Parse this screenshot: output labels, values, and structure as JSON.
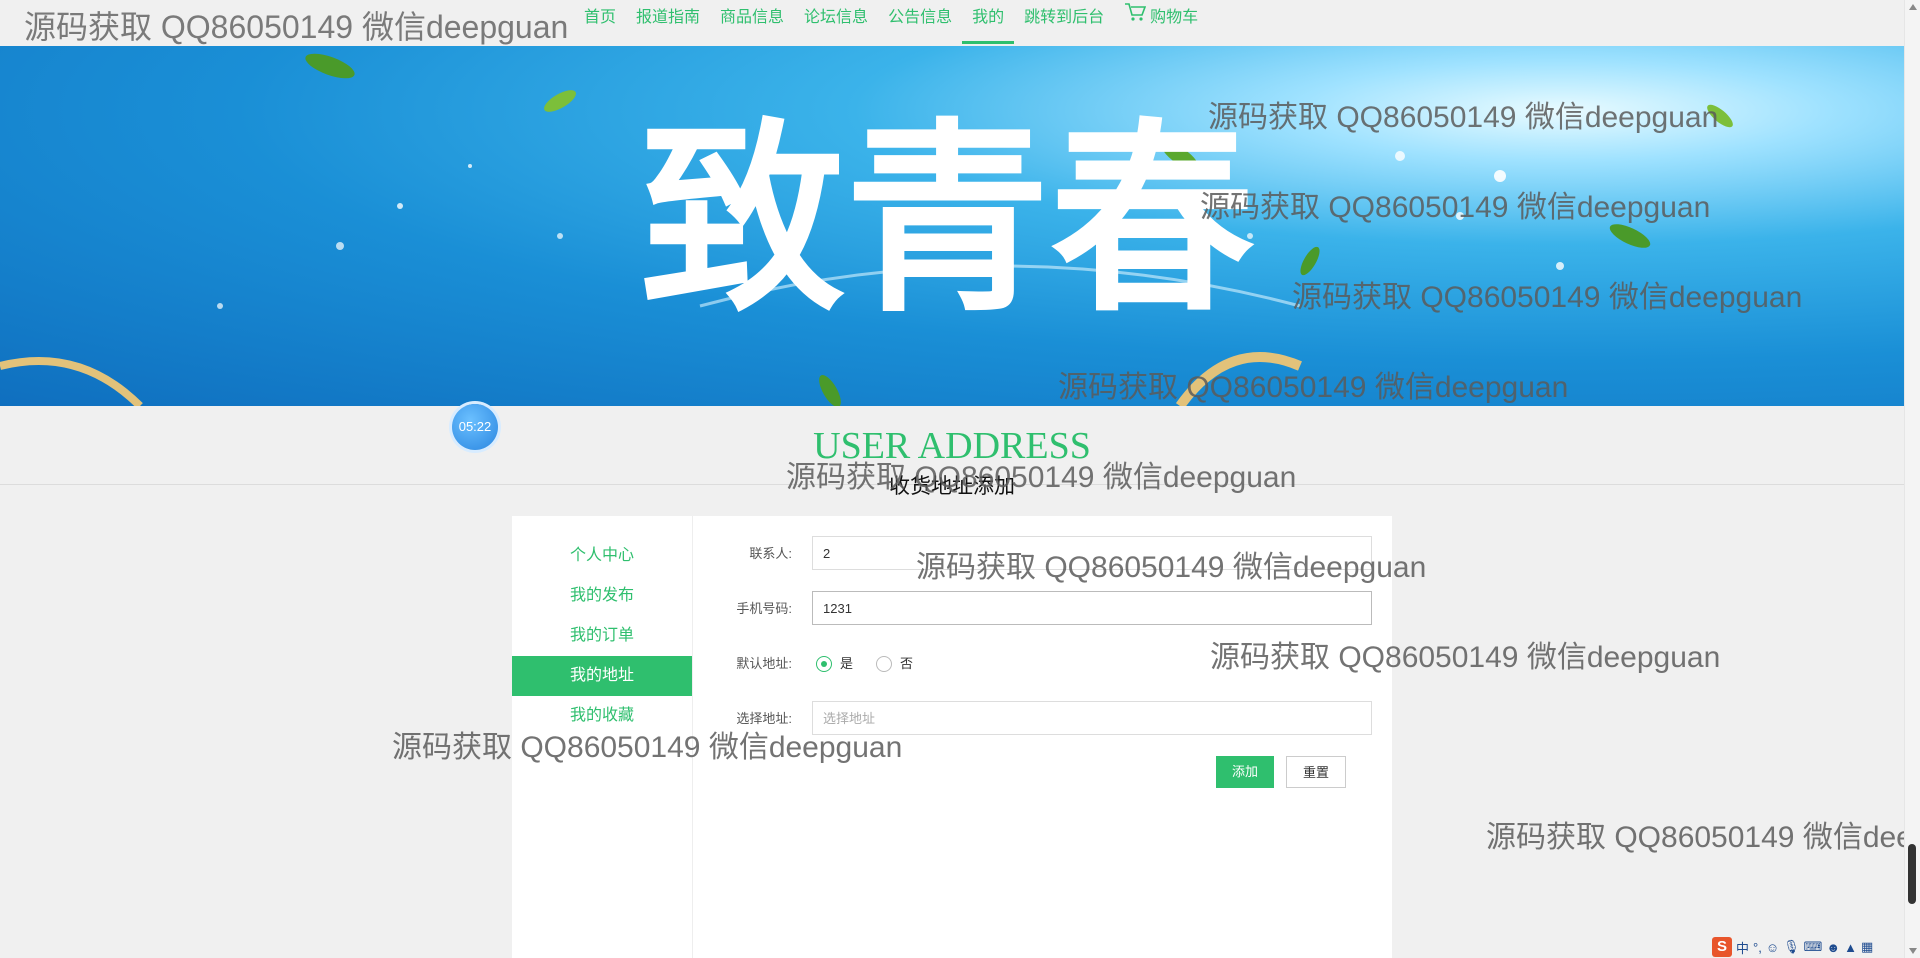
{
  "brand": "源码获取 QQ86050149 微信deepguan",
  "nav": {
    "items": [
      "首页",
      "报道指南",
      "商品信息",
      "论坛信息",
      "公告信息",
      "我的",
      "跳转到后台"
    ],
    "cart": "购物车",
    "active": "我的"
  },
  "banner": {
    "title": "致青春"
  },
  "timer": "05:22",
  "header": {
    "title": "USER ADDRESS",
    "subtitle": "收货地址添加"
  },
  "sidebar": {
    "items": [
      {
        "label": "个人中心"
      },
      {
        "label": "我的发布"
      },
      {
        "label": "我的订单"
      },
      {
        "label": "我的地址"
      },
      {
        "label": "我的收藏"
      }
    ],
    "active": "我的地址"
  },
  "form": {
    "contact": {
      "label": "联系人:",
      "value": "2"
    },
    "phone": {
      "label": "手机号码:",
      "value": "1231"
    },
    "default": {
      "label": "默认地址:",
      "yes": "是",
      "no": "否",
      "selected": "是"
    },
    "address": {
      "label": "选择地址:",
      "placeholder": "选择地址"
    },
    "add_button": "添加",
    "reset_button": "重置"
  },
  "watermark": "源码获取 QQ86050149 微信deepguan",
  "ime": {
    "lang": "中",
    "punct": "°,"
  },
  "colors": {
    "accent": "#2fbf6e",
    "banner": "#1a8fd6"
  }
}
